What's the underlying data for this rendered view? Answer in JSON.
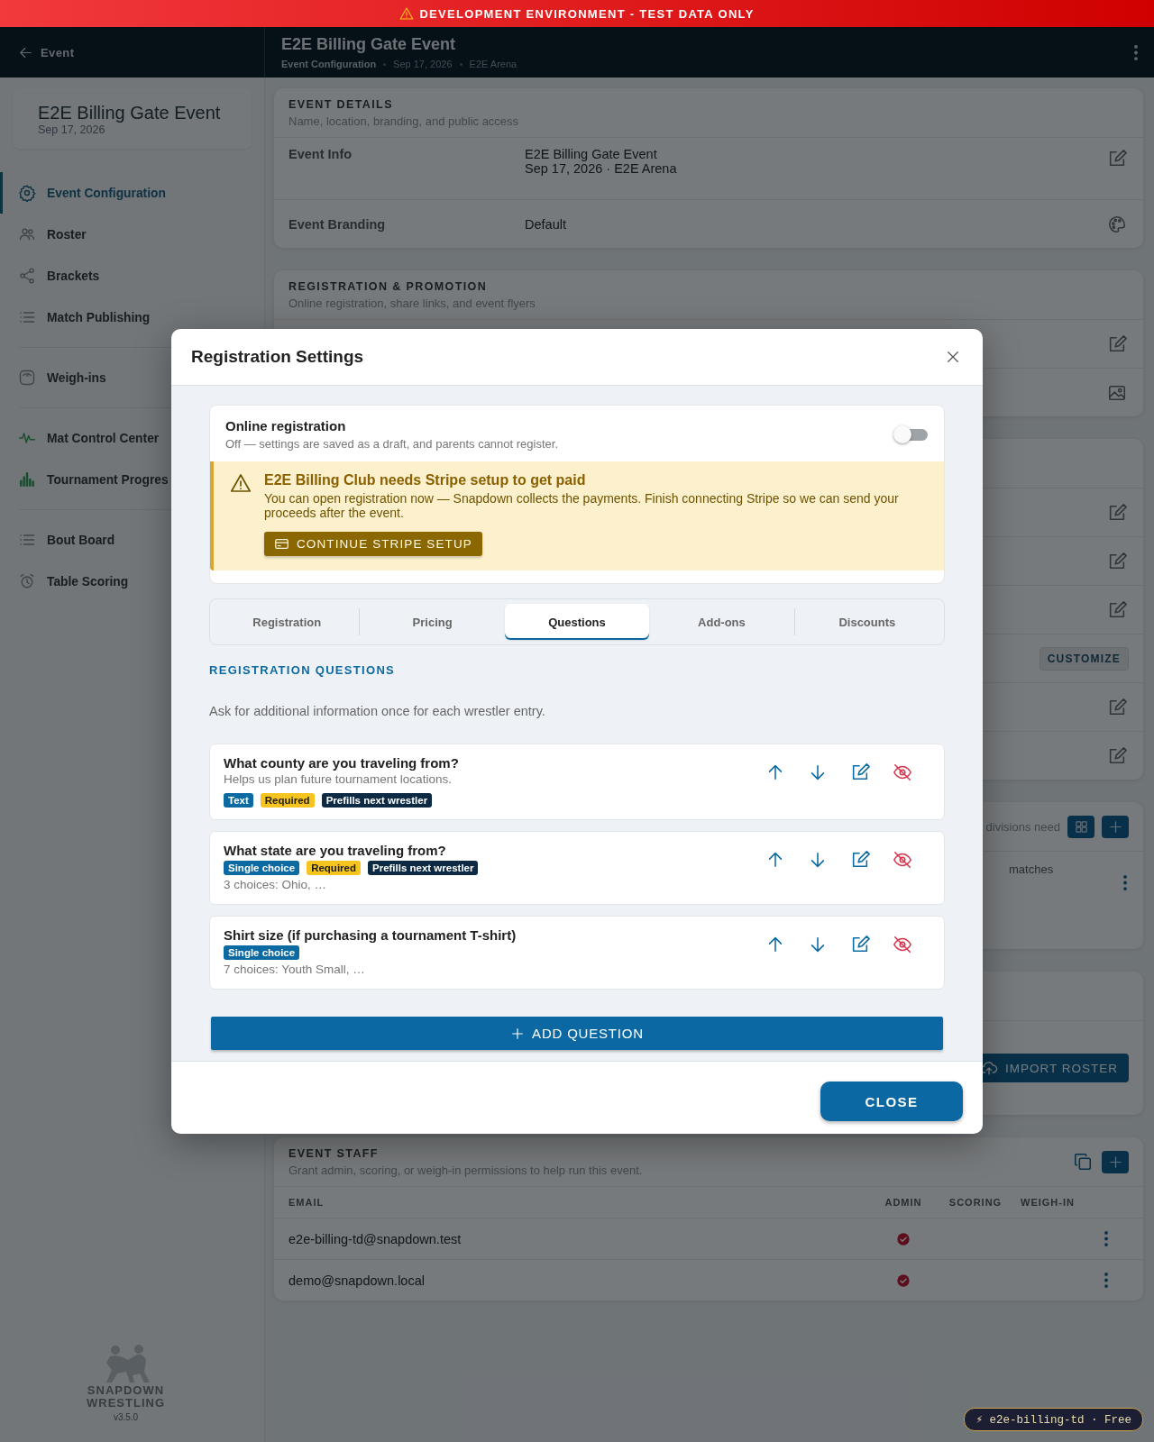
{
  "dev_banner": {
    "text": "DEVELOPMENT ENVIRONMENT - TEST DATA ONLY"
  },
  "header": {
    "back_label": "Event",
    "title": "E2E Billing Gate Event",
    "breadcrumbs": [
      "Event Configuration",
      "Sep 17, 2026",
      "E2E Arena"
    ]
  },
  "sidebar": {
    "event_card": {
      "title": "E2E Billing Gate Event",
      "date": "Sep 17, 2026"
    },
    "groups": [
      {
        "items": [
          {
            "label": "Event Configuration",
            "selected": true
          },
          {
            "label": "Roster",
            "selected": false
          },
          {
            "label": "Brackets",
            "selected": false
          },
          {
            "label": "Match Publishing",
            "selected": false
          }
        ]
      },
      {
        "items": [
          {
            "label": "Weigh-ins",
            "selected": false
          }
        ]
      },
      {
        "items": [
          {
            "label": "Mat Control Center",
            "selected": false
          },
          {
            "label": "Tournament Progres",
            "selected": false
          }
        ]
      },
      {
        "items": [
          {
            "label": "Bout Board",
            "selected": false
          },
          {
            "label": "Table Scoring",
            "selected": false
          }
        ]
      }
    ],
    "logo": {
      "line1": "SNAPDOWN",
      "line2": "WRESTLING",
      "version": "v3.5.0"
    }
  },
  "cards": [
    {
      "title": "EVENT DETAILS",
      "subtitle": "Name, location, branding, and public access",
      "rows": [
        {
          "label": "Event Info",
          "value_lines": [
            "E2E Billing Gate Event",
            "Sep 17, 2026 · E2E Arena"
          ],
          "action": {
            "kind": "edit"
          }
        },
        {
          "label": "Event Branding",
          "value_lines": [
            "Default"
          ],
          "action": {
            "kind": "palette"
          }
        }
      ]
    },
    {
      "title": "REGISTRATION & PROMOTION",
      "subtitle": "Online registration, share links, and event flyers",
      "rows": [
        {
          "action": {
            "kind": "edit"
          }
        },
        {
          "action": {
            "kind": "image"
          }
        }
      ]
    },
    {
      "rows": [
        {
          "action": {
            "kind": "edit"
          }
        },
        {
          "action": {
            "kind": "edit"
          }
        },
        {
          "action": {
            "kind": "edit"
          }
        },
        {
          "action": {
            "kind": "button",
            "label": "CUSTOMIZE"
          }
        },
        {
          "action": {
            "kind": "edit"
          }
        },
        {
          "action": {
            "kind": "edit"
          }
        }
      ]
    },
    {
      "header_text": "divisions need",
      "rows": [
        {
          "text": "matches",
          "action": {
            "kind": "kebab"
          }
        }
      ]
    },
    {
      "rows": [
        {
          "action": {
            "kind": "import",
            "label": "IMPORT ROSTER"
          }
        }
      ]
    }
  ],
  "staff": {
    "title": "EVENT STAFF",
    "subtitle": "Grant admin, scoring, or weigh-in permissions to help run this event.",
    "columns": [
      "EMAIL",
      "ADMIN",
      "SCORING",
      "WEIGH-IN"
    ],
    "rows": [
      {
        "email": "e2e-billing-td@snapdown.test",
        "admin": true
      },
      {
        "email": "demo@snapdown.local",
        "admin": true
      }
    ]
  },
  "modal": {
    "title": "Registration Settings",
    "online_registration": {
      "title": "Online registration",
      "subtitle": "Off — settings are saved as a draft, and parents cannot register.",
      "on": false
    },
    "alert": {
      "title": "E2E Billing Club needs Stripe setup to get paid",
      "body": "You can open registration now — Snapdown collects the payments. Finish connecting Stripe so we can send your proceeds after the event.",
      "button": "CONTINUE STRIPE SETUP"
    },
    "tabs": [
      {
        "label": "Registration",
        "selected": false
      },
      {
        "label": "Pricing",
        "selected": false
      },
      {
        "label": "Questions",
        "selected": true
      },
      {
        "label": "Add-ons",
        "selected": false
      },
      {
        "label": "Discounts",
        "selected": false
      }
    ],
    "section_title": "REGISTRATION QUESTIONS",
    "section_description": "Ask for additional information once for each wrestler entry.",
    "questions": [
      {
        "title": "What county are you traveling from?",
        "help": "Helps us plan future tournament locations.",
        "tags": [
          {
            "label": "Text",
            "kind": "type"
          },
          {
            "label": "Required",
            "kind": "required"
          },
          {
            "label": "Prefills next wrestler",
            "kind": "prefill"
          }
        ]
      },
      {
        "title": "What state are you traveling from?",
        "tags": [
          {
            "label": "Single choice",
            "kind": "type"
          },
          {
            "label": "Required",
            "kind": "required"
          },
          {
            "label": "Prefills next wrestler",
            "kind": "prefill"
          }
        ],
        "summary": "3 choices: Ohio, …"
      },
      {
        "title": "Shirt size (if purchasing a tournament T-shirt)",
        "tags": [
          {
            "label": "Single choice",
            "kind": "type"
          }
        ],
        "summary": "7 choices: Youth Small, …"
      }
    ],
    "add_button": "ADD QUESTION",
    "close_button": "CLOSE"
  },
  "env_badge": "⚡ e2e-billing-td · Free"
}
